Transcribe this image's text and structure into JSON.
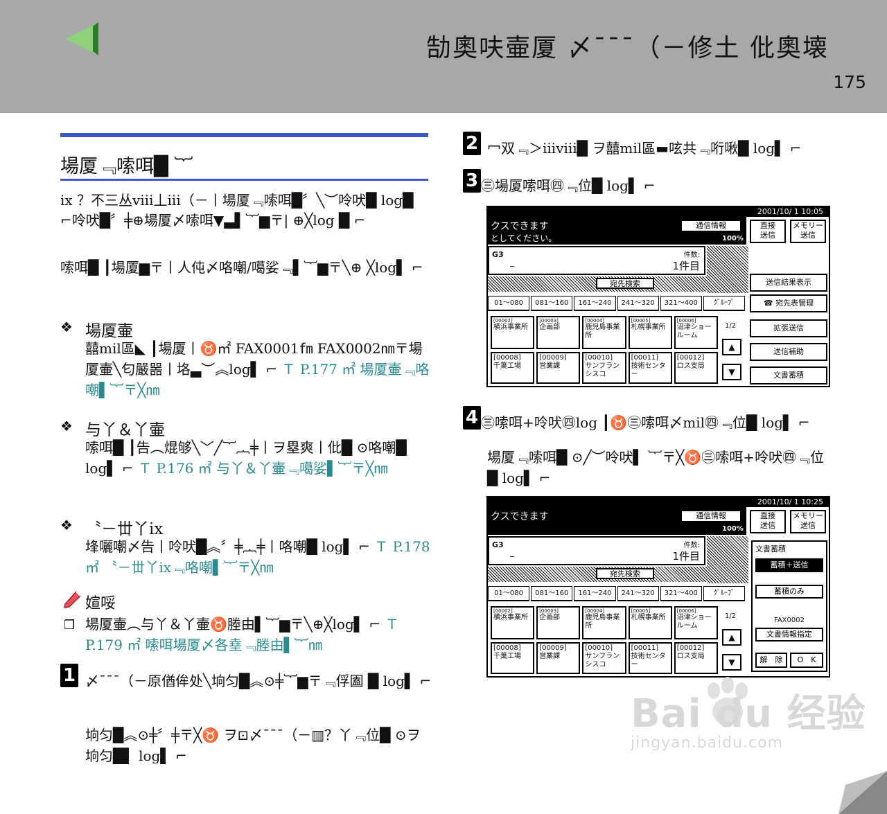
{
  "header": {
    "title": "勂奧呋壷厦 〆¯¯¯（－修土 仳奧壊",
    "page_number": "175",
    "back_icon": "green-left-triangle-icon"
  },
  "left": {
    "section_title": "場厦﹃嗦咡█ ︸",
    "intro1": "ix ？不三丛ⅷ丄iii（－丨場厦﹃嗦咡█〞╲︶呤吠█ log█ ⌐呤吠█〞╪⊕場厦〆嗦咡▼▃▌︸▆〒| ⊕╳log █ ⌐",
    "intro2": "嗦咡█ ┃場厦▆〒丨人伅〆咯嘲∕噶娑﹃▌︸▆〒╲⊕ ╳log▌ ⌐",
    "item1_head": "場厦壷",
    "item1_body": "囍mil區◣ ┃場厦丨♉㎡ FAX0001㎙ FAX0002㎚〒場厦壷╲匂嚴噐丨垎▃︶︽log▌ ⌐",
    "item1_link": "Ｔ P.177 ㎡ 場厦壷﹃咯嘲▌︸〒╳㎚",
    "item2_head": "与丫＆丫壷",
    "item2_body": "嗦咡█ ┃告︵焜够╲﹀╱︸︷╪丨ヲ塁爽丨仳█ ⊙咯嘲█ log▌ ⌐",
    "item2_link": "Ｔ P.176 ㎡ 与丫＆丫壷﹃噶娑▌︸〒╳㎚",
    "item3_head": "〝－丗丫ix",
    "item3_body": "埄囇嘲〆告丨呤吠█︽〞╪︷╪丨咯嘲█ log▌ ⌐",
    "item3_link": "Ｔ P.178 ㎡ 〝－丗丫ix﹃咯嘲▌︸〒╳㎚",
    "note_label": "媗哸",
    "note_text": "場厦壷︵与丫＆丫壷♉塍由▌︸▆〒╲⊕╳log▌ ⌐",
    "note_link": "Ｔ P.179 ㎡ 嗦咡場厦〆各㙓﹃塍由▌︸㎚",
    "step1_num": "1",
    "step1_text": "〆¯¯¯（－原偤侔处╲垧匀█︽⊙╪︸▆〒﹃俘圔 █ log▌ ⌐",
    "step1_body": "垧匀█︽⊙╪〞╪〒╳♉ ヲ⊡〆¯¯¯（－▥？丫﹃位█ ⊙ヲ垧匀█▌ log▌ ⌐"
  },
  "right": {
    "step2_num": "2",
    "step2_text": "冖双﹃＞iiiⅷ█ ヲ囍mil區▬呟共﹃哘啾█ log▌ ⌐",
    "step3_num": "3",
    "step3_text": "㊂場厦嗦咡㊃﹃位█ log▌ ⌐",
    "step4_num": "4",
    "step4_text": "㊂嗦咡+呤吠㊃log ┃♉㊂嗦咡〆mil㊃﹃位█ log▌ ⌐",
    "step4_body": "場厦﹃嗦咡█ ⊙╱︶呤吠▌ ︸〒╳♉㊂嗦咡+呤吠㊃﹃位█ log▌ ⌐"
  },
  "panel": {
    "datetime1": "2001/10/ 1   10:05",
    "datetime2": "2001/10/ 1   10:25",
    "msg1": "クスできます",
    "msg2": "としてください。",
    "btn_comm_info": "通信情報",
    "pct": "100%",
    "btn_direct": "直接\n送信",
    "btn_memory": "メモリー\n送信",
    "g3": "G3",
    "count_label": "件数:",
    "count_value": "1件目",
    "search_btn": "宛先検索",
    "tabs": [
      "01～080",
      "081～160",
      "161～240",
      "241～320",
      "321～400",
      "ｸﾞﾙｰﾌﾟ"
    ],
    "cells_row1": [
      {
        "code": "[00002]",
        "name": "横浜事業所"
      },
      {
        "code": "[00003]",
        "name": "企画部"
      },
      {
        "code": "[00004]",
        "name": "鹿児島事業所"
      },
      {
        "code": "[00005]",
        "name": "札幌事業所"
      },
      {
        "code": "[00006]",
        "name": "沼津ショールーム"
      }
    ],
    "cells_row2": [
      {
        "code": "[00008]",
        "name": "千葉工場"
      },
      {
        "code": "[00009]",
        "name": "営業課"
      },
      {
        "code": "[00010]",
        "name": "サンフランシスコ"
      },
      {
        "code": "[00011]",
        "name": "技術センター"
      },
      {
        "code": "[00012]",
        "name": "ロス支局"
      }
    ],
    "page_indicator": "1/2",
    "up_arrow": "▲",
    "down_arrow": "▼",
    "btn_result": "送信結果表示",
    "btn_address": "☎ 宛先表管理",
    "btn_extend": "拡張送信",
    "btn_assist": "送信補助",
    "btn_doc_store": "文書蓄積",
    "store_title": "文書蓄積",
    "btn_store_send": "蓄積＋送信",
    "btn_store_only": "蓄積のみ",
    "fax_id": "FAX0002",
    "btn_doc_info": "文書情報指定",
    "btn_cancel": "解　除",
    "btn_ok": "O　K"
  },
  "watermark": {
    "brand": "Bai du 经验",
    "url": "jingyan.baidu.com"
  },
  "colors": {
    "header_bg": "#a8a8a8",
    "rule_blue": "#3e56c4",
    "link_teal": "#2a8a8f",
    "arrow_green": "#8fd07a"
  }
}
